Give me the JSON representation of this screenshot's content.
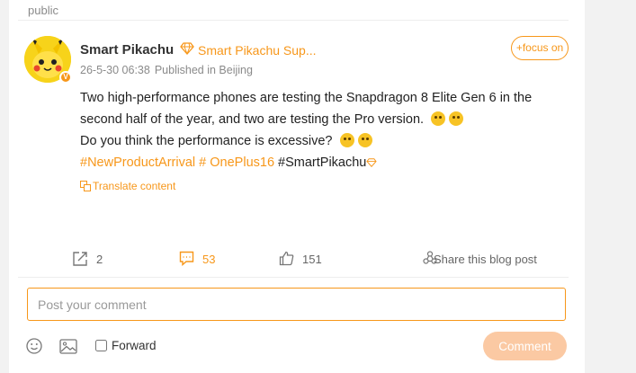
{
  "top": {
    "visibility": "public"
  },
  "post": {
    "username": "Smart Pikachu",
    "group": "Smart Pikachu Sup...",
    "verify_badge": "V",
    "timestamp": "26-5-30 06:38",
    "location": "Published in Beijing",
    "follow_label": "+focus on",
    "line1": "Two high-performance phones are testing the Snapdragon 8 Elite Gen 6 in the second half of the year, and two are testing the Pro version.",
    "line2": "Do you think the performance is excessive?",
    "tag1": "#NewProductArrival",
    "tag2": "# OnePlus16",
    "tag3": "#SmartPikachu",
    "translate_label": "Translate content"
  },
  "actions": {
    "repost_count": "2",
    "comment_count": "53",
    "like_count": "151",
    "share_label": "Share this blog post"
  },
  "composer": {
    "placeholder": "Post your comment",
    "forward_label": "Forward",
    "submit_label": "Comment"
  },
  "colors": {
    "accent": "#f7971a",
    "button_disabled": "#fbc9a3"
  },
  "icons": [
    "emoji-icon",
    "image-icon",
    "repost-icon",
    "comment-icon",
    "like-icon",
    "share-icon",
    "diamond-icon",
    "translate-icon"
  ]
}
